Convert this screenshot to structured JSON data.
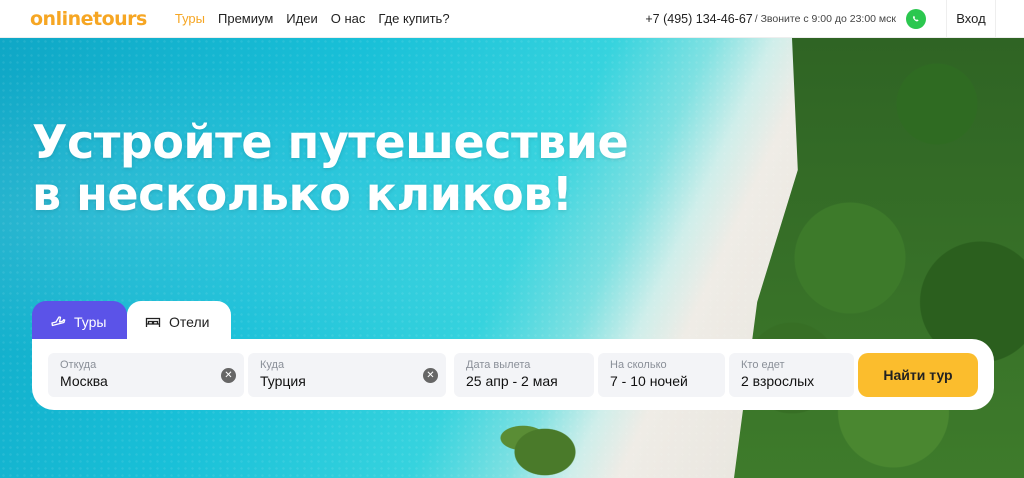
{
  "header": {
    "logo": "onlinetours",
    "nav": [
      "Туры",
      "Премиум",
      "Идеи",
      "О нас",
      "Где купить?"
    ],
    "phone": "+7 (495) 134-46-67",
    "phone_note": "/ Звоните с 9:00 до 23:00 мск",
    "login": "Вход"
  },
  "hero": {
    "headline_line1": "Устройте путешествие",
    "headline_line2": "в несколько кликов!"
  },
  "search": {
    "tabs": [
      {
        "label": "Туры",
        "icon": "plane-icon",
        "active": true
      },
      {
        "label": "Отели",
        "icon": "bed-icon",
        "active": false
      }
    ],
    "from": {
      "label": "Откуда",
      "value": "Москва"
    },
    "to": {
      "label": "Куда",
      "value": "Турция"
    },
    "dates": {
      "label": "Дата вылета",
      "value": "25 апр - 2 мая"
    },
    "nights": {
      "label": "На сколько",
      "value": "7 - 10 ночей"
    },
    "guests": {
      "label": "Кто едет",
      "value": "2 взрослых"
    },
    "submit": "Найти тур"
  },
  "colors": {
    "brand": "#f6a623",
    "tab_active": "#5b53e8",
    "button": "#fbbd2d",
    "whatsapp": "#2bc74f"
  }
}
